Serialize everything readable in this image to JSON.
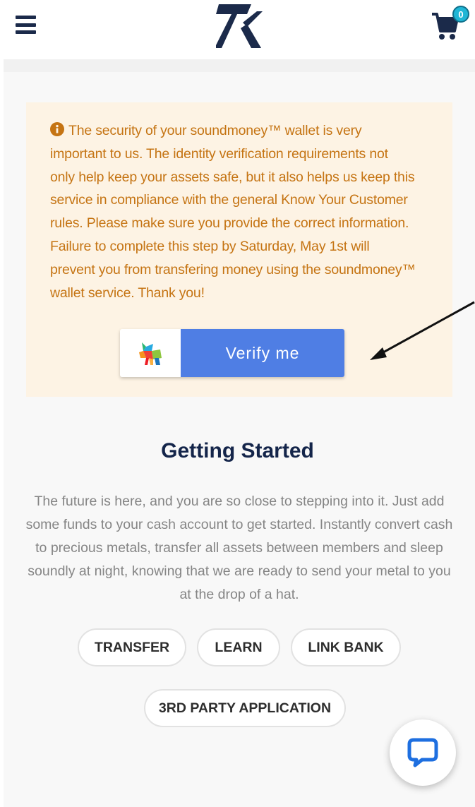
{
  "header": {
    "menu_icon": "hamburger-icon",
    "logo_text": "7k",
    "cart_icon": "cart-icon",
    "cart_count": "0"
  },
  "notice": {
    "icon": "info-icon",
    "lines": [
      "The security of your soundmoney™ wallet is very",
      "important to us. The identity verification requirements not",
      "only help keep your assets safe, but it also helps us keep this",
      "service in compliance with the general Know Your Customer",
      "rules. Please make sure you provide the correct information.",
      "Failure to complete this step by Saturday, May 1st will",
      "prevent you from transfering money using the soundmoney™",
      "wallet service. Thank you!"
    ],
    "verify_label": "Verify me",
    "verify_logo_icon": "wolf-logo-icon"
  },
  "getting_started": {
    "title": "Getting Started",
    "lines": [
      "The future is here, and you are so close to stepping into it. Just add",
      "some funds to your cash account to get started. Instantly convert cash",
      "to precious metals, transfer all assets between members and sleep",
      "soundly at night, knowing that we are ready to send your metal to you",
      "at the drop of a hat."
    ],
    "buttons": [
      "TRANSFER",
      "LEARN",
      "LINK BANK",
      "3RD PARTY APPLICATION"
    ]
  },
  "chat": {
    "icon": "chat-bubble-icon"
  },
  "colors": {
    "navy": "#1b2a4a",
    "notice_bg": "#fdf3e4",
    "notice_text": "#c57413",
    "verify_blue": "#4f7ee4",
    "badge": "#1fb6d6"
  }
}
